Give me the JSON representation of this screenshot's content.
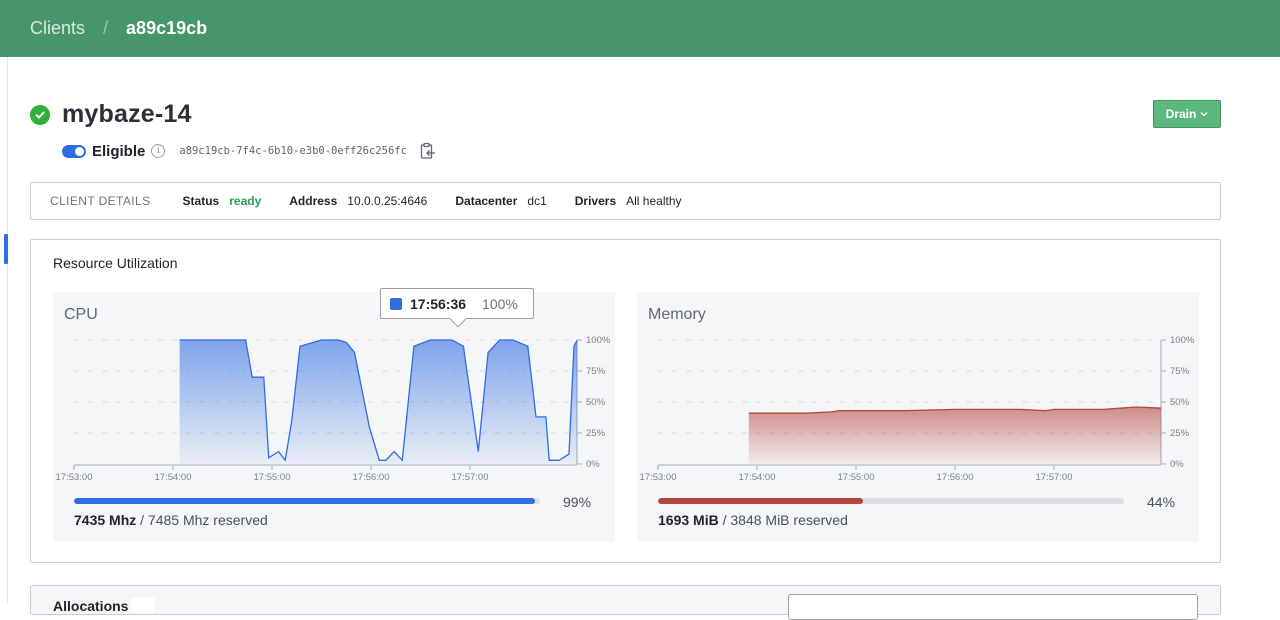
{
  "breadcrumb": {
    "root": "Clients",
    "separator": "/",
    "current": "a89c19cb"
  },
  "client": {
    "name": "mybaze-14",
    "eligible_label": "Eligible",
    "id": "a89c19cb-7f4c-6b10-e3b0-0eff26c256fc",
    "drain_label": "Drain"
  },
  "details": {
    "heading": "Client Details",
    "status_label": "Status",
    "status_value": "ready",
    "address_label": "Address",
    "address_value": "10.0.0.25:4646",
    "datacenter_label": "Datacenter",
    "datacenter_value": "dc1",
    "drivers_label": "Drivers",
    "drivers_value": "All healthy"
  },
  "resources": {
    "title": "Resource Utilization",
    "cpu": {
      "title": "CPU",
      "percent_label": "99%",
      "percent": 0.99,
      "used": "7435 Mhz",
      "reserved": "/ 7485 Mhz reserved",
      "color": "#2f6de1"
    },
    "memory": {
      "title": "Memory",
      "percent_label": "44%",
      "percent": 0.44,
      "used": "1693 MiB",
      "reserved": "/ 3848 MiB reserved",
      "color": "#b5463d"
    },
    "tooltip": {
      "time": "17:56:36",
      "value": "100%"
    }
  },
  "allocations": {
    "title": "Allocations"
  },
  "chart_data": [
    {
      "type": "area",
      "title": "CPU",
      "x_ticks": [
        "17:53:00",
        "17:54:00",
        "17:55:00",
        "17:56:00",
        "17:57:00"
      ],
      "y_ticks": [
        "100%",
        "75%",
        "50%",
        "25%",
        "0%"
      ],
      "ylim": [
        0,
        100
      ],
      "grid": true,
      "series": [
        {
          "color": "#2f6de1",
          "x": [
            "17:54:04",
            "17:54:25",
            "17:54:44",
            "17:54:48",
            "17:54:55",
            "17:54:58",
            "17:55:04",
            "17:55:08",
            "17:55:12",
            "17:55:17",
            "17:55:30",
            "17:55:40",
            "17:55:45",
            "17:55:50",
            "17:55:59",
            "17:56:05",
            "17:56:09",
            "17:56:14",
            "17:56:19",
            "17:56:26",
            "17:56:36",
            "17:56:49",
            "17:56:56",
            "17:57:05",
            "17:57:11",
            "17:57:18",
            "17:57:26",
            "17:57:35",
            "17:57:40",
            "17:57:46",
            "17:57:48",
            "17:57:54",
            "17:58:00",
            "17:58:03",
            "17:58:05"
          ],
          "y": [
            100,
            100,
            100,
            70,
            70,
            5,
            10,
            3,
            35,
            95,
            100,
            100,
            98,
            90,
            30,
            3,
            3,
            10,
            3,
            95,
            100,
            100,
            95,
            10,
            90,
            100,
            100,
            95,
            38,
            38,
            3,
            3,
            8,
            95,
            100
          ]
        }
      ]
    },
    {
      "type": "area",
      "title": "Memory",
      "x_ticks": [
        "17:53:00",
        "17:54:00",
        "17:55:00",
        "17:56:00",
        "17:57:00"
      ],
      "y_ticks": [
        "100%",
        "75%",
        "50%",
        "25%",
        "0%"
      ],
      "ylim": [
        0,
        100
      ],
      "grid": true,
      "series": [
        {
          "color": "#b5463d",
          "x": [
            "17:53:55",
            "17:54:30",
            "17:54:45",
            "17:54:50",
            "17:55:30",
            "17:56:00",
            "17:56:15",
            "17:56:40",
            "17:56:55",
            "17:57:00",
            "17:57:30",
            "17:57:40",
            "17:57:50",
            "17:58:05"
          ],
          "y": [
            41,
            41,
            42,
            43,
            43,
            44,
            44,
            44,
            43,
            44,
            44,
            45,
            46,
            45
          ]
        }
      ]
    }
  ]
}
